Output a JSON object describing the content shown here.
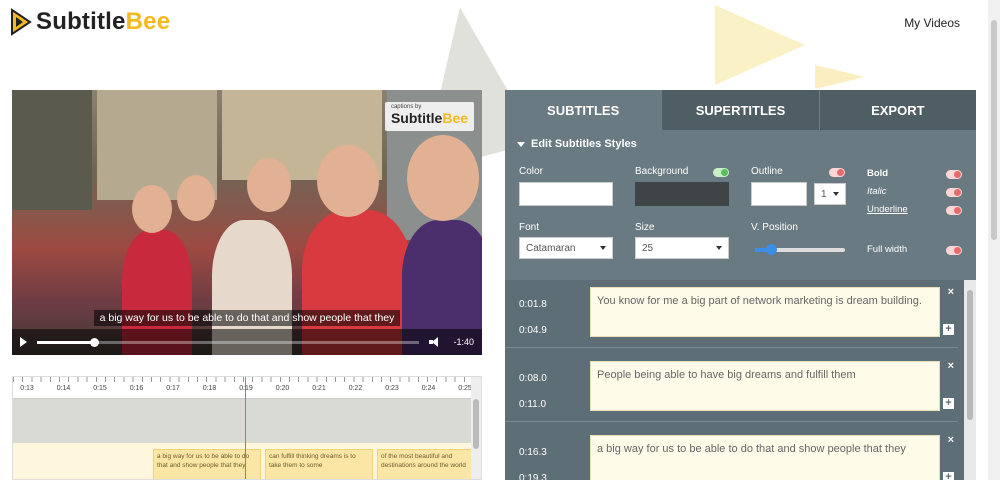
{
  "header": {
    "brand_main": "Subtitle",
    "brand_accent": "Bee",
    "nav_my_videos": "My Videos"
  },
  "colors": {
    "accent": "#f5b921",
    "panel": "#5e6e76",
    "toggle_on": "#5bbd5b",
    "toggle_off": "#e86b6b"
  },
  "video": {
    "watermark_small": "captions by",
    "watermark_brand": "Subtitle",
    "watermark_accent": "Bee",
    "caption": "a big way for us to be able to do that and show people that they",
    "duration": "-1:40",
    "progress_fraction": 0.15
  },
  "timeline": {
    "ticks": [
      "0:13",
      "0:14",
      "0:15",
      "0:16",
      "0:17",
      "0:18",
      "0:19",
      "0:20",
      "0:21",
      "0:22",
      "0:23",
      "0:24",
      "0:25"
    ],
    "cues": [
      "a big way for us to be able to do that and show people that they",
      "can fulfill thinking dreams is to take them to some",
      "of the most beautiful and destinations around the world"
    ]
  },
  "tabs": [
    "SUBTITLES",
    "SUPERTITLES",
    "EXPORT"
  ],
  "styles": {
    "heading": "Edit Subtitles Styles",
    "color_label": "Color",
    "background_label": "Background",
    "outline_label": "Outline",
    "outline_width": "1",
    "bold_label": "Bold",
    "italic_label": "Italic",
    "underline_label": "Underline",
    "font_label": "Font",
    "font_value": "Catamaran",
    "size_label": "Size",
    "size_value": "25",
    "vposition_label": "V. Position",
    "fullwidth_label": "Full width",
    "vposition_fraction": 0.18
  },
  "subtitles": [
    {
      "start": "0:01.8",
      "end": "0:04.9",
      "text": "You know for me a big part of network marketing is dream building."
    },
    {
      "start": "0:08.0",
      "end": "0:11.0",
      "text": "People being able to have big dreams and fulfill them"
    },
    {
      "start": "0:16.3",
      "end": "0:19.3",
      "text": "a big way for us to be able to do that and show people that they"
    }
  ]
}
